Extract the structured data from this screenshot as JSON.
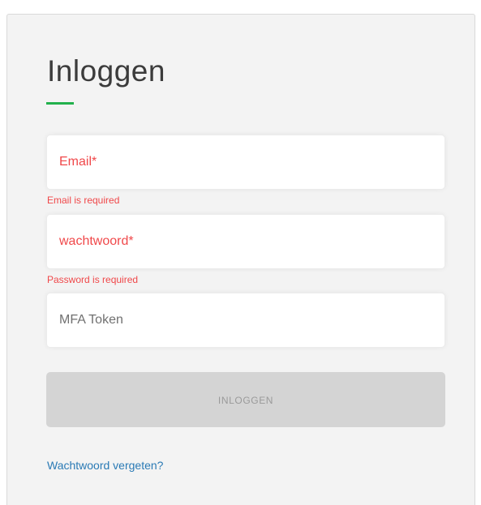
{
  "login": {
    "title": "Inloggen",
    "email_placeholder": "Email*",
    "email_error": "Email is required",
    "password_placeholder": "wachtwoord*",
    "password_error": "Password is required",
    "mfa_placeholder": "MFA Token",
    "submit_label": "INLOGGEN",
    "forgot_link": "Wachtwoord vergeten?"
  },
  "colors": {
    "accent": "#22b14c",
    "error": "#f0484a",
    "link": "#2a7ab5",
    "disabled_button": "#d4d4d4"
  }
}
